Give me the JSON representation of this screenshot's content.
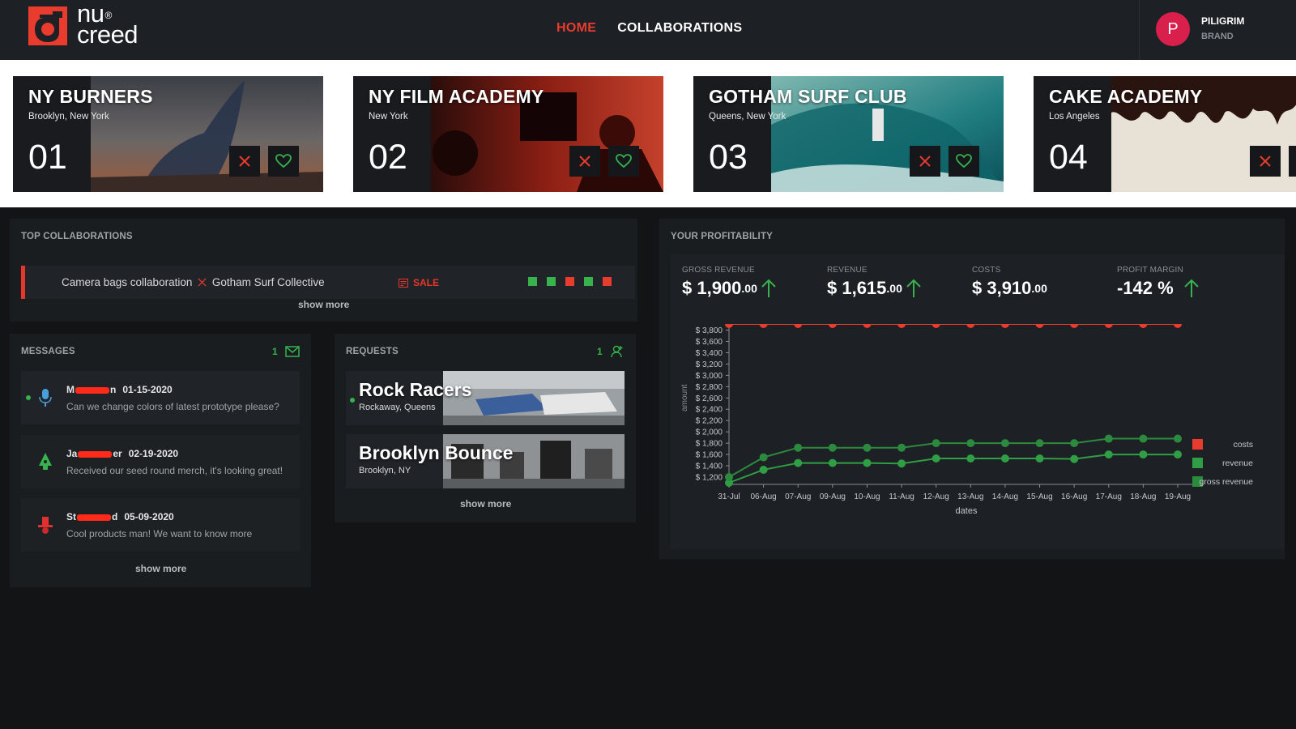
{
  "app": {
    "logo_top": "nu",
    "logo_sup": "®",
    "logo_bottom": "creed",
    "accent": "#ea3b2f",
    "positive": "#37b24d"
  },
  "nav": {
    "home": "HOME",
    "collaborations": "COLLABORATIONS"
  },
  "user": {
    "initial": "P",
    "name": "PILIGRIM",
    "role": "BRAND"
  },
  "cards": [
    {
      "title": "NY BURNERS",
      "location": "Brooklyn, New York",
      "number": "01"
    },
    {
      "title": "NY FILM ACADEMY",
      "location": "New York",
      "number": "02"
    },
    {
      "title": "GOTHAM SURF CLUB",
      "location": "Queens, New York",
      "number": "03"
    },
    {
      "title": "CAKE ACADEMY",
      "location": "Los Angeles",
      "number": "04"
    }
  ],
  "top_collaborations": {
    "title": "TOP COLLABORATIONS",
    "item_left": "Camera bags collaboration",
    "item_right": "Gotham Surf Collective",
    "tag": "SALE",
    "status_squares": [
      "green",
      "green",
      "red",
      "green",
      "red"
    ],
    "show_more": "show more"
  },
  "messages": {
    "title": "MESSAGES",
    "count": "1",
    "items": [
      {
        "name_start": "M",
        "name_end": "n",
        "date": "01-15-2020",
        "text": "Can we change colors of latest prototype please?"
      },
      {
        "name_start": "Ja",
        "name_end": "er",
        "date": "02-19-2020",
        "text": "Received our seed round merch, it's looking great!"
      },
      {
        "name_start": "St",
        "name_end": "d",
        "date": "05-09-2020",
        "text": "Cool products man! We want to know more"
      }
    ],
    "show_more": "show more"
  },
  "requests": {
    "title": "REQUESTS",
    "count": "1",
    "items": [
      {
        "name": "Rock Racers",
        "location": "Rockaway, Queens"
      },
      {
        "name": "Brooklyn Bounce",
        "location": "Brooklyn, NY"
      }
    ],
    "show_more": "show more"
  },
  "profitability": {
    "title": "YOUR PROFITABILITY",
    "metrics": [
      {
        "label": "GROSS REVENUE",
        "main": "$ 1,900",
        "cents": ".00",
        "trend": "up"
      },
      {
        "label": "REVENUE",
        "main": "$ 1,615",
        "cents": ".00",
        "trend": "up"
      },
      {
        "label": "COSTS",
        "main": "$ 3,910",
        "cents": ".00",
        "trend": "none"
      },
      {
        "label": "PROFIT MARGIN",
        "main": "-142 %",
        "cents": "",
        "trend": "up"
      }
    ]
  },
  "chart_data": {
    "type": "line",
    "xlabel": "dates",
    "ylabel": "amount",
    "x": [
      "31-Jul",
      "06-Aug",
      "07-Aug",
      "09-Aug",
      "10-Aug",
      "11-Aug",
      "12-Aug",
      "13-Aug",
      "14-Aug",
      "15-Aug",
      "16-Aug",
      "17-Aug",
      "18-Aug",
      "19-Aug"
    ],
    "y_ticks": [
      "$ 1,200",
      "$ 1,400",
      "$ 1,600",
      "$ 1,800",
      "$ 2,000",
      "$ 2,200",
      "$ 2,400",
      "$ 2,600",
      "$ 2,800",
      "$ 3,000",
      "$ 3,200",
      "$ 3,400",
      "$ 3,600",
      "$ 3,800"
    ],
    "ylim": [
      1100,
      3850
    ],
    "grid": false,
    "legend_position": "right",
    "series": [
      {
        "name": "costs",
        "color": "#ea3b2f",
        "values": [
          3910,
          3910,
          3910,
          3910,
          3910,
          3910,
          3910,
          3910,
          3910,
          3910,
          3910,
          3910,
          3910,
          3910
        ]
      },
      {
        "name": "revenue",
        "color": "#2f9e44",
        "values": [
          1100,
          1330,
          1450,
          1450,
          1450,
          1440,
          1530,
          1530,
          1530,
          1530,
          1520,
          1600,
          1600,
          1600
        ]
      },
      {
        "name": "gross revenue",
        "color": "#2b8a3e",
        "values": [
          1200,
          1550,
          1720,
          1720,
          1720,
          1720,
          1800,
          1800,
          1800,
          1800,
          1800,
          1880,
          1880,
          1880
        ]
      }
    ]
  }
}
